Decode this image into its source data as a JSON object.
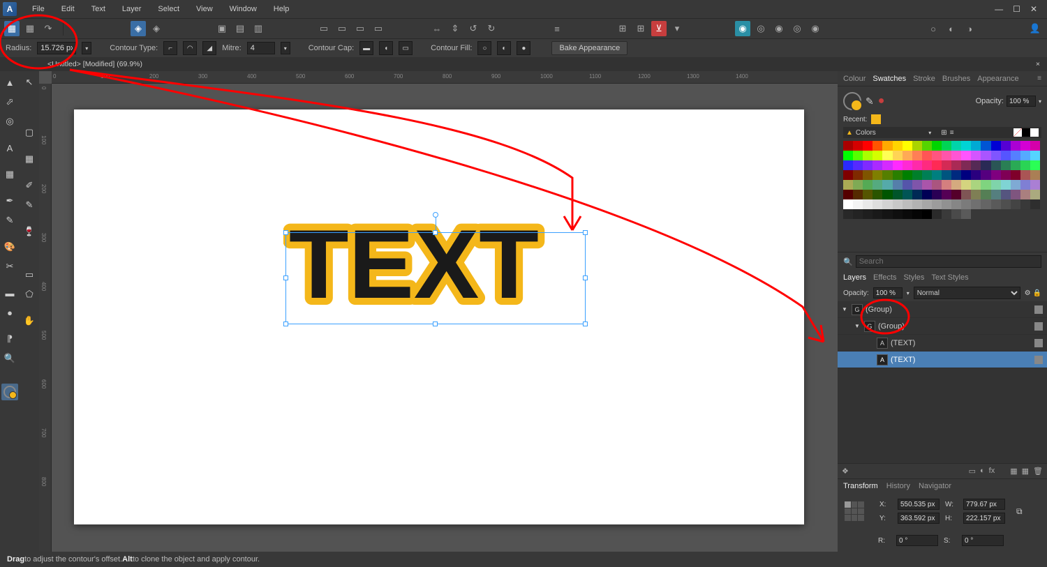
{
  "menu": {
    "items": [
      "File",
      "Edit",
      "Text",
      "Layer",
      "Select",
      "View",
      "Window",
      "Help"
    ]
  },
  "context": {
    "radius_label": "Radius:",
    "radius_value": "15.726 px",
    "contour_type_label": "Contour Type:",
    "mitre_label": "Mitre:",
    "mitre_value": "4",
    "contour_cap_label": "Contour Cap:",
    "contour_fill_label": "Contour Fill:",
    "bake_label": "Bake Appearance"
  },
  "doc": {
    "tab": "<Untitled> [Modified] (69.9%)"
  },
  "canvas_text": "TEXT",
  "swatch_tabs": [
    "Colour",
    "Swatches",
    "Stroke",
    "Brushes",
    "Appearance"
  ],
  "swatch": {
    "opacity_label": "Opacity:",
    "opacity_value": "100 %",
    "recent_label": "Recent:",
    "colors_label": "Colors"
  },
  "search_placeholder": "Search",
  "layer_tabs": [
    "Layers",
    "Effects",
    "Styles",
    "Text Styles"
  ],
  "layer_opacity": {
    "label": "Opacity:",
    "value": "100 %",
    "blend": "Normal"
  },
  "layers": [
    {
      "indent": 0,
      "name": "(Group)",
      "sel": false,
      "exp": "▼",
      "icon": "G"
    },
    {
      "indent": 1,
      "name": "(Group)",
      "sel": false,
      "exp": "▼",
      "icon": "G"
    },
    {
      "indent": 2,
      "name": "(TEXT)",
      "sel": false,
      "exp": "",
      "icon": "A"
    },
    {
      "indent": 2,
      "name": "(TEXT)",
      "sel": true,
      "exp": "",
      "icon": "A"
    }
  ],
  "transform_tabs": [
    "Transform",
    "History",
    "Navigator"
  ],
  "transform": {
    "x_label": "X:",
    "x": "550.535 px",
    "y_label": "Y:",
    "y": "363.592 px",
    "w_label": "W:",
    "w": "779.67 px",
    "h_label": "H:",
    "h": "222.157 px",
    "r_label": "R:",
    "r": "0 °",
    "s_label": "S:",
    "s": "0 °"
  },
  "status": {
    "drag": "Drag",
    "drag_txt": " to adjust the contour's offset. ",
    "alt": "Alt",
    "alt_txt": " to clone the object and apply contour."
  },
  "palette_colors": [
    "#aa0000",
    "#d40000",
    "#ff0000",
    "#ff5500",
    "#ffaa00",
    "#ffd400",
    "#ffff00",
    "#aad400",
    "#55d400",
    "#00d400",
    "#00d455",
    "#00d4aa",
    "#00d4d4",
    "#00aad4",
    "#0055d4",
    "#0000d4",
    "#5500d4",
    "#aa00d4",
    "#d400d4",
    "#d400aa",
    "#00ff00",
    "#55ff00",
    "#aaff00",
    "#d4ff00",
    "#ffff55",
    "#ffd455",
    "#ffaa55",
    "#ff7f55",
    "#ff5555",
    "#ff557f",
    "#ff55aa",
    "#ff55d4",
    "#ff55ff",
    "#d455ff",
    "#aa55ff",
    "#7f55ff",
    "#5555ff",
    "#557fff",
    "#55aaff",
    "#55d4ff",
    "#2a2aff",
    "#552aff",
    "#7f2aff",
    "#aa2aff",
    "#d42aff",
    "#ff2aff",
    "#ff2ad4",
    "#ff2aaa",
    "#ff2a7f",
    "#ff2a55",
    "#d42a55",
    "#aa2a55",
    "#7f2a55",
    "#552a55",
    "#2a2a55",
    "#2a5555",
    "#2a7f55",
    "#2aaa55",
    "#2ad455",
    "#2aff55",
    "#7f0000",
    "#7f2a00",
    "#7f5500",
    "#7f7f00",
    "#557f00",
    "#2a7f00",
    "#007f00",
    "#007f2a",
    "#007f55",
    "#007f7f",
    "#00557f",
    "#002a7f",
    "#00007f",
    "#2a007f",
    "#55007f",
    "#7f007f",
    "#7f0055",
    "#7f002a",
    "#aa5555",
    "#aa7f55",
    "#aaaa55",
    "#7faa55",
    "#55aa55",
    "#55aa7f",
    "#55aaaa",
    "#557faa",
    "#5555aa",
    "#7f55aa",
    "#aa55aa",
    "#aa557f",
    "#d47f7f",
    "#d4aa7f",
    "#d4d47f",
    "#aad47f",
    "#7fd47f",
    "#7fd4aa",
    "#7fd4d4",
    "#7faad4",
    "#7f7fd4",
    "#aa7fd4",
    "#550000",
    "#552a00",
    "#555500",
    "#2a5500",
    "#005500",
    "#00552a",
    "#005555",
    "#002a55",
    "#000055",
    "#2a0055",
    "#550055",
    "#55002a",
    "#7f5555",
    "#7f7f55",
    "#557f55",
    "#557f7f",
    "#55557f",
    "#7f557f",
    "#aa7f7f",
    "#aaaa7f",
    "#ffffff",
    "#f4f4f4",
    "#e9e9e9",
    "#dedede",
    "#d3d3d3",
    "#c8c8c8",
    "#bdbdbd",
    "#b2b2b2",
    "#a7a7a7",
    "#9c9c9c",
    "#919191",
    "#868686",
    "#7b7b7b",
    "#707070",
    "#656565",
    "#5a5a5a",
    "#4f4f4f",
    "#444444",
    "#393939",
    "#2e2e2e",
    "#282828",
    "#232323",
    "#1e1e1e",
    "#191919",
    "#141414",
    "#0f0f0f",
    "#0a0a0a",
    "#050505",
    "#000000",
    "#2a2a2a",
    "#3a3a3a",
    "#4a4a4a",
    "#5a5a5a",
    "",
    "",
    "",
    "",
    "",
    "",
    ""
  ]
}
